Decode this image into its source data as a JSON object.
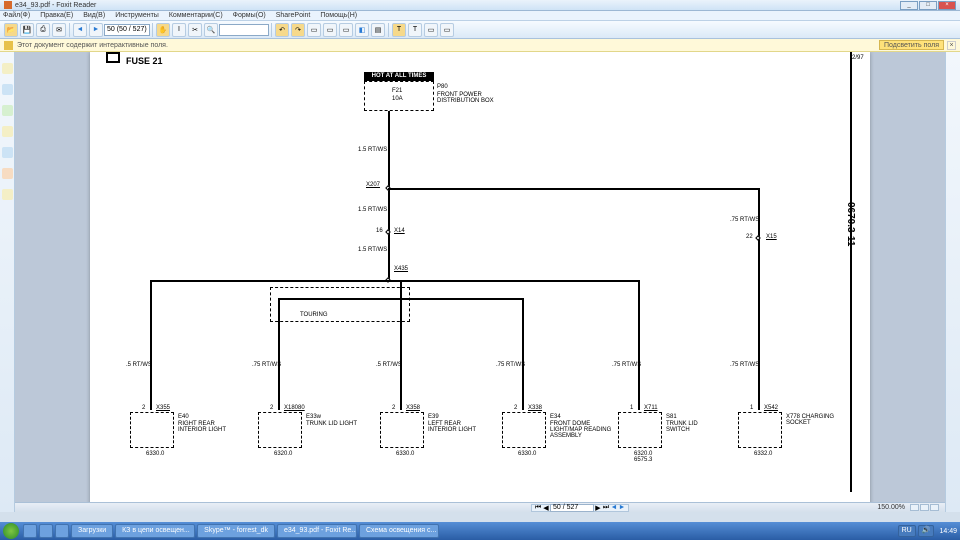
{
  "titlebar": {
    "title": "e34_93.pdf - Foxit Reader"
  },
  "menu": [
    "Файл(Ф)",
    "Правка(Е)",
    "Вид(В)",
    "Инструменты",
    "Комментарии(С)",
    "Формы(О)",
    "SharePoint",
    "Помощь(Н)"
  ],
  "toolbar": {
    "page_display": "50 (50 / 527)"
  },
  "notice": {
    "text": "Этот документ содержит интерактивные поля.",
    "highlight": "Подсветить поля"
  },
  "statusbar": {
    "page": "50 / 527",
    "zoom": "150.00%"
  },
  "taskbar": {
    "items": [
      "Загрузки",
      "КЗ в цепи освещен...",
      "Skype™ - forrest_dk",
      "e34_93.pdf - Foxit Re...",
      "Схема освещения с..."
    ],
    "lang": "RU",
    "clock": "14:49"
  },
  "diagram": {
    "title": "FUSE 21",
    "hot_header": "HOT AT ALL TIMES",
    "fuse": {
      "id": "F21",
      "rating": "10A",
      "conn": "P80",
      "desc": "FRONT POWER DISTRIBUTION BOX"
    },
    "wires": {
      "w1": "1.5 RT/WS",
      "w2": "1.5 RT/WS",
      "w3": "1.5 RT/WS",
      "w4": ".75 RT/WS"
    },
    "conn_points": {
      "x207": "X207",
      "x14": "X14",
      "x14pin": "16",
      "x15": "X15",
      "x15pin": "22",
      "x435": "X435"
    },
    "touring": "TOURING",
    "branch_wires": [
      ".5 RT/WS",
      ".75 RT/WS",
      ".5 RT/WS",
      ".75 RT/WS",
      ".75 RT/WS",
      ".75 RT/WS"
    ],
    "pins": [
      "2",
      "2",
      "2",
      "2",
      "1",
      "1"
    ],
    "footers": [
      "6330.0",
      "6320.0",
      "6330.0",
      "6330.0",
      "6320.0\n6575.3",
      "6332.0"
    ],
    "right_label": "0670.3-11",
    "right_top": "2/97",
    "boxes": [
      {
        "conn": "X355",
        "id": "E40",
        "desc": "RIGHT REAR INTERIOR LIGHT"
      },
      {
        "conn": "X18080",
        "id": "E33w",
        "desc": "TRUNK LID LIGHT"
      },
      {
        "conn": "X358",
        "id": "E39",
        "desc": "LEFT REAR INTERIOR LIGHT"
      },
      {
        "conn": "X338",
        "id": "E34",
        "desc": "FRONT DOME LIGHT/MAP READING ASSEMBLY"
      },
      {
        "conn": "X711",
        "id": "S81",
        "desc": "TRUNK LID SWITCH"
      },
      {
        "conn": "X542",
        "id": "X778 CHARGING SOCKET"
      }
    ]
  }
}
